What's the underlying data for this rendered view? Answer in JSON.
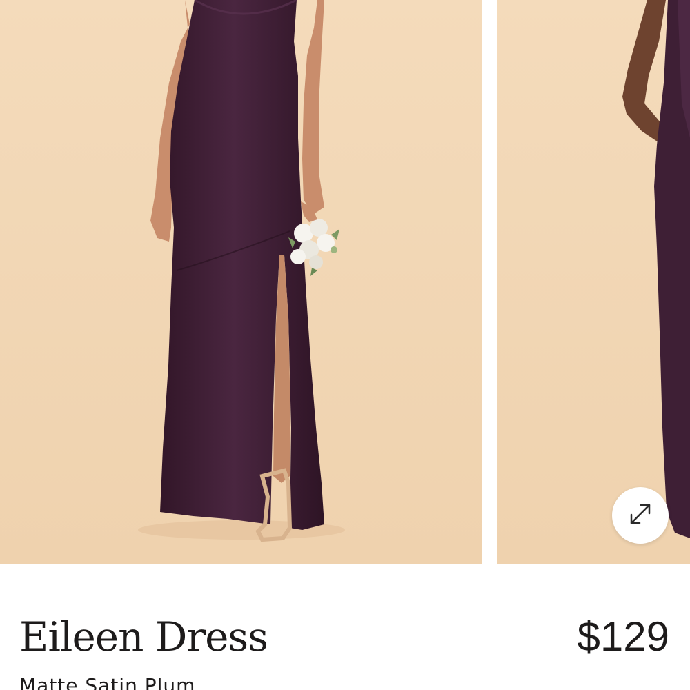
{
  "gallery": {
    "images": [
      {
        "alt": "",
        "subject": "model-in-plum-halter-dress-with-bouquet"
      },
      {
        "alt": "",
        "subject": "model-in-plum-dress-partial-view"
      }
    ],
    "expand_icon": "expand-arrows-icon"
  },
  "product": {
    "name": "Eileen Dress",
    "price": "$129",
    "variant": "Matte Satin Plum"
  },
  "colors": {
    "backdrop": "#f2d7b6",
    "dress_plum": "#3e1f35",
    "text": "#1d1b1b",
    "background": "#ffffff"
  }
}
